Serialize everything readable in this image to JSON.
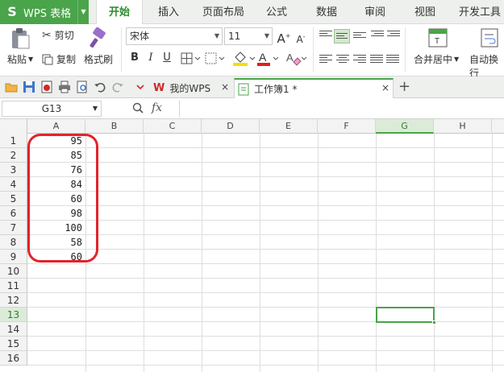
{
  "app": {
    "name": "WPS 表格"
  },
  "menu_tabs": [
    {
      "label": "开始",
      "active": true
    },
    {
      "label": "插入"
    },
    {
      "label": "页面布局"
    },
    {
      "label": "公式"
    },
    {
      "label": "数据"
    },
    {
      "label": "审阅"
    },
    {
      "label": "视图"
    },
    {
      "label": "开发工具"
    }
  ],
  "ribbon": {
    "cut": "剪切",
    "paste": "粘贴",
    "copy": "复制",
    "format_painter": "格式刷",
    "font_name": "宋体",
    "font_size": "11",
    "merge_center": "合并居中",
    "wrap_text": "自动换行"
  },
  "doc_tabs": [
    {
      "label": "我的WPS"
    },
    {
      "label": "工作簿1 *",
      "active": true
    }
  ],
  "formula_bar": {
    "name_box": "G13",
    "fx": "fx",
    "content": ""
  },
  "columns": [
    "A",
    "B",
    "C",
    "D",
    "E",
    "F",
    "G",
    "H"
  ],
  "rows": [
    "1",
    "2",
    "3",
    "4",
    "5",
    "6",
    "7",
    "8",
    "9",
    "10",
    "11",
    "12",
    "13",
    "14",
    "15",
    "16"
  ],
  "selected_cell": {
    "column": "G",
    "row": "13"
  },
  "column_a_values": [
    "95",
    "85",
    "76",
    "84",
    "60",
    "98",
    "100",
    "58",
    "60"
  ],
  "colors": {
    "accent": "#4aa44a",
    "highlight_ring": "#e2232b"
  }
}
